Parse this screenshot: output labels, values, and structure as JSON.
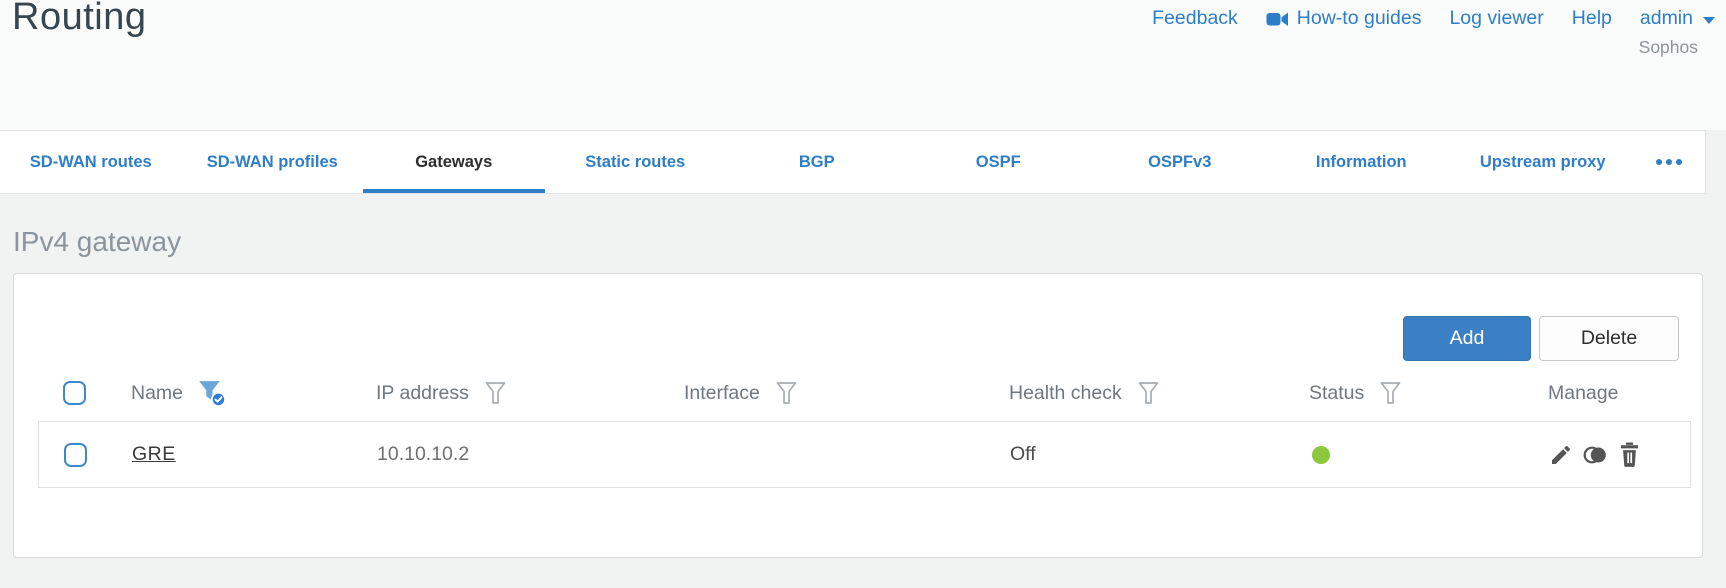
{
  "header": {
    "title": "Routing",
    "brand": "Sophos",
    "nav": {
      "feedback": "Feedback",
      "howto_guides": "How-to guides",
      "log_viewer": "Log viewer",
      "help": "Help",
      "user": "admin"
    }
  },
  "tabs": {
    "items": [
      {
        "label": "SD-WAN routes",
        "active": false
      },
      {
        "label": "SD-WAN profiles",
        "active": false
      },
      {
        "label": "Gateways",
        "active": true
      },
      {
        "label": "Static routes",
        "active": false
      },
      {
        "label": "BGP",
        "active": false
      },
      {
        "label": "OSPF",
        "active": false
      },
      {
        "label": "OSPFv3",
        "active": false
      },
      {
        "label": "Information",
        "active": false
      },
      {
        "label": "Upstream proxy",
        "active": false
      }
    ],
    "more_icon": "ellipsis-icon"
  },
  "section": {
    "heading": "IPv4 gateway"
  },
  "toolbar": {
    "add_label": "Add",
    "delete_label": "Delete"
  },
  "table": {
    "columns": [
      {
        "label": "Name",
        "filter": "active"
      },
      {
        "label": "IP address",
        "filter": "inactive"
      },
      {
        "label": "Interface",
        "filter": "inactive"
      },
      {
        "label": "Health check",
        "filter": "inactive"
      },
      {
        "label": "Status",
        "filter": "inactive"
      },
      {
        "label": "Manage",
        "filter": "none"
      }
    ],
    "rows": [
      {
        "name": "GRE",
        "ip_address": "10.10.10.2",
        "interface": "",
        "health_check": "Off",
        "status": "green-up",
        "manage_icons": [
          "edit-icon",
          "clone-icon",
          "delete-icon"
        ]
      }
    ]
  },
  "colors": {
    "link_blue": "#2e7ec7",
    "button_blue": "#3b80c4",
    "active_filter_blue": "#6ba6da",
    "status_green": "#8dc63f"
  }
}
